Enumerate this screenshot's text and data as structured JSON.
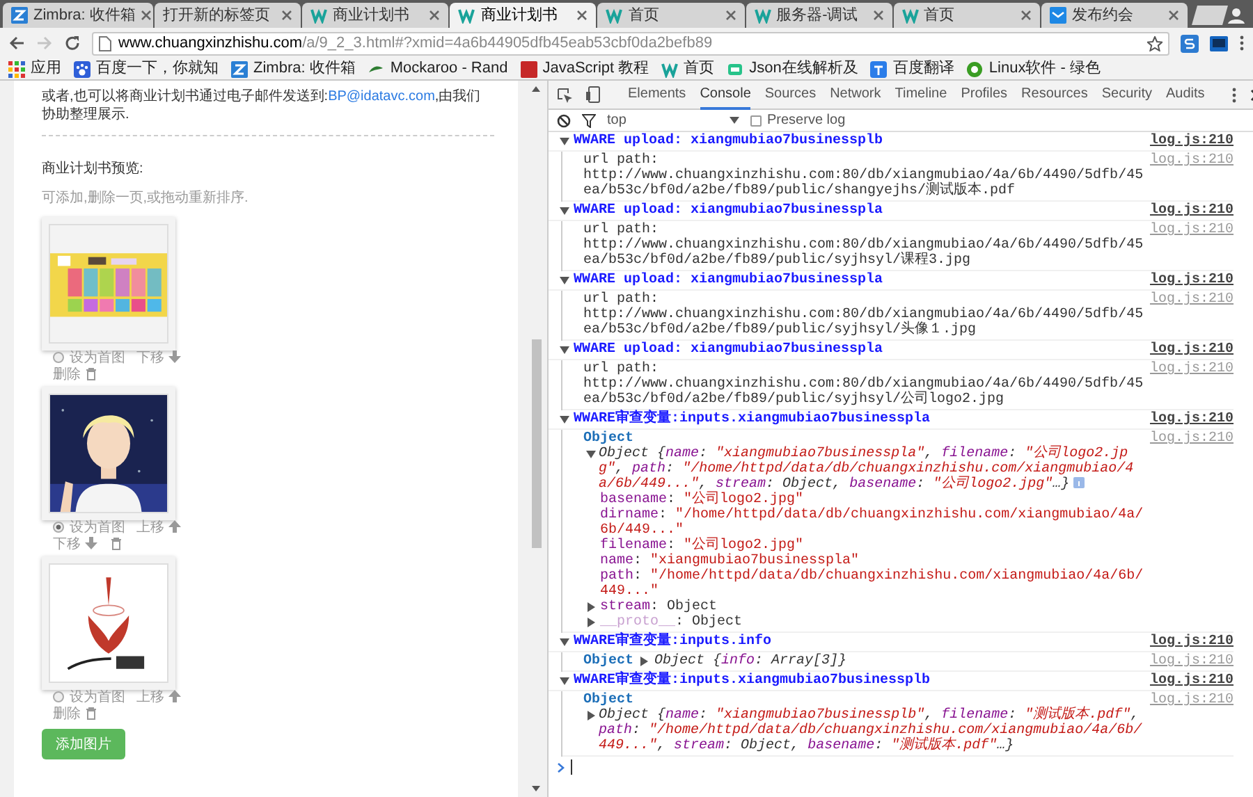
{
  "tabs": [
    {
      "title": "Zimbra: 收件箱",
      "selected": false
    },
    {
      "title": "打开新的标签页",
      "selected": false
    },
    {
      "title": "商业计划书",
      "selected": false
    },
    {
      "title": "商业计划书",
      "selected": true
    },
    {
      "title": "首页",
      "selected": false
    },
    {
      "title": "服务器-调试",
      "selected": false
    },
    {
      "title": "首页",
      "selected": false
    },
    {
      "title": "发布约会",
      "selected": false
    }
  ],
  "toolbar": {
    "forward_disabled": true,
    "url_host": "www.chuangxinzhishu.com",
    "url_rest": "/a/9_2_3.html#?xmid=4a6b44905dfb45eab53cbf0da2befb89"
  },
  "bookmarks": [
    {
      "label": "应用"
    },
    {
      "label": "百度一下，你就知"
    },
    {
      "label": "Zimbra: 收件箱"
    },
    {
      "label": "Mockaroo - Rand"
    },
    {
      "label": "JavaScript 教程"
    },
    {
      "label": "首页"
    },
    {
      "label": "Json在线解析及"
    },
    {
      "label": "百度翻译"
    },
    {
      "label": "Linux软件 - 绿色"
    }
  ],
  "page": {
    "intro_before": "或者,也可以将商业计划书通过电子邮件发送到:",
    "intro_link": "BP@idatavc.com",
    "intro_after": ",由我们协助整理展示.",
    "heading": "商业计划书预览:",
    "hint": "可添加,删除一页,或拖动重新排序.",
    "cards": [
      {
        "cover": false,
        "cover_label": "设为首图",
        "actions": [
          {
            "kind": "down",
            "label": "下移"
          },
          {
            "kind": "delete",
            "label": "删除"
          }
        ]
      },
      {
        "cover": true,
        "cover_label": "设为首图",
        "actions": [
          {
            "kind": "up",
            "label": "上移"
          },
          {
            "kind": "down",
            "label": "下移"
          },
          {
            "kind": "delete"
          }
        ]
      },
      {
        "cover": false,
        "cover_label": "设为首图",
        "actions": [
          {
            "kind": "up",
            "label": "上移"
          },
          {
            "kind": "delete",
            "label": "删除"
          }
        ]
      }
    ],
    "add_button": "添加图片"
  },
  "devtools": {
    "tabs": [
      {
        "label": "Elements",
        "selected": false
      },
      {
        "label": "Console",
        "selected": true
      },
      {
        "label": "Sources",
        "selected": false
      },
      {
        "label": "Network",
        "selected": false
      },
      {
        "label": "Timeline",
        "selected": false
      },
      {
        "label": "Profiles",
        "selected": false
      },
      {
        "label": "Resources",
        "selected": false
      },
      {
        "label": "Security",
        "selected": false
      },
      {
        "label": "Audits",
        "selected": false
      }
    ],
    "context": "top",
    "preserve_log": {
      "label": "Preserve log",
      "checked": false
    },
    "groups": [
      {
        "title": "WWARE upload: xiangmubiao7businessplb",
        "source": "log.js:210",
        "expanded": true,
        "messages": [
          {
            "kind": "text",
            "source": "log.js:210",
            "lines": [
              "url path:",
              "http://www.chuangxinzhishu.com:80/db/xiangmubiao/4a/6b/4490/5dfb/45ea/b53c/bf0d/a2be/fb89/public/shangyejhs/测试版本.pdf"
            ]
          }
        ]
      },
      {
        "title": "WWARE upload: xiangmubiao7businesspla",
        "source": "log.js:210",
        "expanded": true,
        "messages": [
          {
            "kind": "text",
            "source": "log.js:210",
            "lines": [
              "url path:",
              "http://www.chuangxinzhishu.com:80/db/xiangmubiao/4a/6b/4490/5dfb/45ea/b53c/bf0d/a2be/fb89/public/syjhsyl/课程3.jpg"
            ]
          }
        ]
      },
      {
        "title": "WWARE upload: xiangmubiao7businesspla",
        "source": "log.js:210",
        "expanded": true,
        "messages": [
          {
            "kind": "text",
            "source": "log.js:210",
            "lines": [
              "url path:",
              "http://www.chuangxinzhishu.com:80/db/xiangmubiao/4a/6b/4490/5dfb/45ea/b53c/bf0d/a2be/fb89/public/syjhsyl/头像１.jpg"
            ]
          }
        ]
      },
      {
        "title": "WWARE upload: xiangmubiao7businesspla",
        "source": "log.js:210",
        "expanded": true,
        "messages": [
          {
            "kind": "text",
            "source": "log.js:210",
            "lines": [
              "url path:",
              "http://www.chuangxinzhishu.com:80/db/xiangmubiao/4a/6b/4490/5dfb/45ea/b53c/bf0d/a2be/fb89/public/syjhsyl/公司logo2.jpg"
            ]
          }
        ]
      },
      {
        "title": "WWARE审查变量:inputs.xiangmubiao7businesspla",
        "source": "log.js:210",
        "expanded": true,
        "messages": [
          {
            "kind": "object",
            "source": "log.js:210",
            "label": "Object",
            "info_badge": true,
            "preview": {
              "expanded": true,
              "tokens": [
                {
                  "kind": "plain",
                  "text": "Object {"
                },
                {
                  "kind": "key",
                  "text": "name"
                },
                {
                  "kind": "plain",
                  "text": ": "
                },
                {
                  "kind": "string",
                  "text": "\"xiangmubiao7businesspla\""
                },
                {
                  "kind": "plain",
                  "text": ", "
                },
                {
                  "kind": "key",
                  "text": "filename"
                },
                {
                  "kind": "plain",
                  "text": ": "
                },
                {
                  "kind": "string",
                  "text": "\"公司logo2.jpg\""
                },
                {
                  "kind": "plain",
                  "text": ", "
                },
                {
                  "kind": "key",
                  "text": "path"
                },
                {
                  "kind": "plain",
                  "text": ": "
                },
                {
                  "kind": "string",
                  "text": "\"/home/httpd/data/db/chuangxinzhishu.com/xiangmubiao/4a/6b/449...\""
                },
                {
                  "kind": "plain",
                  "text": ", "
                },
                {
                  "kind": "key",
                  "text": "stream"
                },
                {
                  "kind": "plain",
                  "text": ": Object, "
                },
                {
                  "kind": "key",
                  "text": "basename"
                },
                {
                  "kind": "plain",
                  "text": ": "
                },
                {
                  "kind": "string",
                  "text": "\"公司logo2.jpg\""
                },
                {
                  "kind": "plain",
                  "text": "…}"
                }
              ]
            },
            "properties": [
              {
                "key": "basename",
                "sep": ": ",
                "value": "\"公司logo2.jpg\"",
                "kind": "string"
              },
              {
                "key": "dirname",
                "sep": ": ",
                "value": "\"/home/httpd/data/db/chuangxinzhishu.com/xiangmubiao/4a/6b/449...\"",
                "kind": "string"
              },
              {
                "key": "filename",
                "sep": ": ",
                "value": "\"公司logo2.jpg\"",
                "kind": "string"
              },
              {
                "key": "name",
                "sep": ": ",
                "value": "\"xiangmubiao7businesspla\"",
                "kind": "string"
              },
              {
                "key": "path",
                "sep": ": ",
                "value": "\"/home/httpd/data/db/chuangxinzhishu.com/xiangmubiao/4a/6b/449...\"",
                "kind": "string"
              },
              {
                "key": "stream",
                "sep": ": ",
                "value": "Object",
                "kind": "object",
                "expanded": false
              },
              {
                "key": "__proto__",
                "sep": ": ",
                "value": "Object",
                "kind": "proto",
                "expanded": false
              }
            ]
          }
        ]
      },
      {
        "title": "WWARE审查变量:inputs.info",
        "source": "log.js:210",
        "expanded": true,
        "messages": [
          {
            "kind": "object-inline",
            "source": "log.js:210",
            "label": "Object",
            "preview": {
              "expanded": false,
              "tokens": [
                {
                  "kind": "plain",
                  "text": "Object {"
                },
                {
                  "kind": "key",
                  "text": "info"
                },
                {
                  "kind": "plain",
                  "text": ": Array[3]}"
                }
              ]
            }
          }
        ]
      },
      {
        "title": "WWARE审查变量:inputs.xiangmubiao7businessplb",
        "source": "log.js:210",
        "expanded": true,
        "messages": [
          {
            "kind": "object",
            "source": "log.js:210",
            "label": "Object",
            "preview": {
              "expanded": false,
              "tokens": [
                {
                  "kind": "plain",
                  "text": "Object {"
                },
                {
                  "kind": "key",
                  "text": "name"
                },
                {
                  "kind": "plain",
                  "text": ": "
                },
                {
                  "kind": "string",
                  "text": "\"xiangmubiao7businessplb\""
                },
                {
                  "kind": "plain",
                  "text": ", "
                },
                {
                  "kind": "key",
                  "text": "filename"
                },
                {
                  "kind": "plain",
                  "text": ": "
                },
                {
                  "kind": "string",
                  "text": "\"测试版本.pdf\""
                },
                {
                  "kind": "plain",
                  "text": ", "
                },
                {
                  "kind": "key",
                  "text": "path"
                },
                {
                  "kind": "plain",
                  "text": ": "
                },
                {
                  "kind": "string",
                  "text": "\"/home/httpd/data/db/chuangxinzhishu.com/xiangmubiao/4a/6b/449...\""
                },
                {
                  "kind": "plain",
                  "text": ", "
                },
                {
                  "kind": "key",
                  "text": "stream"
                },
                {
                  "kind": "plain",
                  "text": ": Object, "
                },
                {
                  "kind": "key",
                  "text": "basename"
                },
                {
                  "kind": "plain",
                  "text": ": "
                },
                {
                  "kind": "string",
                  "text": "\"测试版本.pdf\""
                },
                {
                  "kind": "plain",
                  "text": "…}"
                }
              ]
            }
          }
        ]
      }
    ]
  }
}
